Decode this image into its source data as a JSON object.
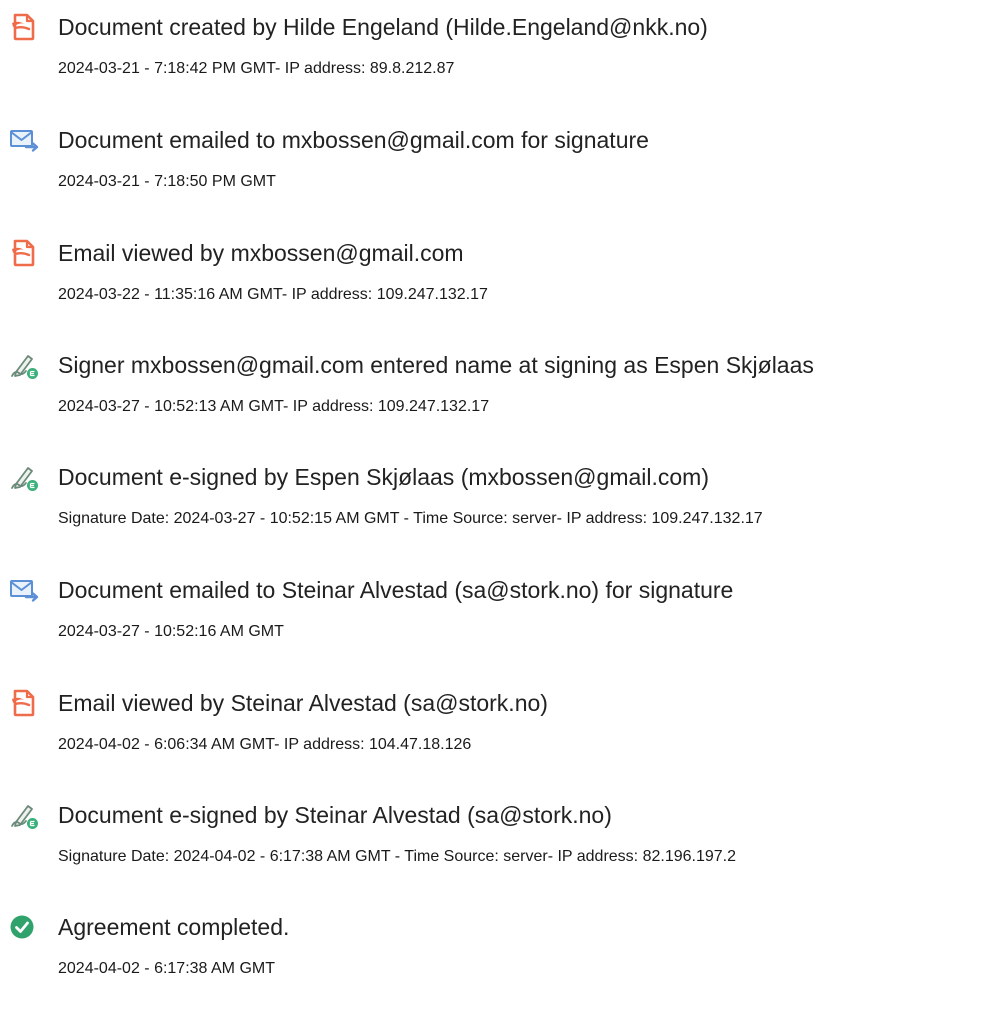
{
  "events": [
    {
      "icon": "document-created-icon",
      "title": "Document created by Hilde Engeland (Hilde.Engeland@nkk.no)",
      "detail": "2024-03-21 - 7:18:42 PM GMT- IP address: 89.8.212.87"
    },
    {
      "icon": "email-sent-icon",
      "title": "Document emailed to mxbossen@gmail.com for signature",
      "detail": "2024-03-21 - 7:18:50 PM GMT"
    },
    {
      "icon": "document-viewed-icon",
      "title": "Email viewed by mxbossen@gmail.com",
      "detail": "2024-03-22 - 11:35:16 AM GMT- IP address: 109.247.132.17"
    },
    {
      "icon": "e-sign-pen-icon",
      "title": "Signer mxbossen@gmail.com entered name at signing as Espen Skjølaas",
      "detail": "2024-03-27 - 10:52:13 AM GMT- IP address: 109.247.132.17"
    },
    {
      "icon": "e-sign-pen-icon",
      "title": "Document e-signed by Espen Skjølaas (mxbossen@gmail.com)",
      "detail": "Signature Date: 2024-03-27 - 10:52:15 AM GMT - Time Source: server- IP address: 109.247.132.17"
    },
    {
      "icon": "email-sent-icon",
      "title": "Document emailed to Steinar Alvestad (sa@stork.no) for signature",
      "detail": "2024-03-27 - 10:52:16 AM GMT"
    },
    {
      "icon": "document-viewed-icon",
      "title": "Email viewed by Steinar Alvestad (sa@stork.no)",
      "detail": "2024-04-02 - 6:06:34 AM GMT- IP address: 104.47.18.126"
    },
    {
      "icon": "e-sign-pen-icon",
      "title": "Document e-signed by Steinar Alvestad (sa@stork.no)",
      "detail": "Signature Date: 2024-04-02 - 6:17:38 AM GMT - Time Source: server- IP address: 82.196.197.2"
    },
    {
      "icon": "agreement-completed-check-icon",
      "title": "Agreement completed.",
      "detail": "2024-04-02 - 6:17:38 AM GMT"
    }
  ],
  "colors": {
    "document_icon": "#ef6c4a",
    "email_icon": "#5b8fd6",
    "pen_icon": "#6c8a7a",
    "pen_badge": "#3ab07a",
    "check_icon": "#2fa36b"
  }
}
